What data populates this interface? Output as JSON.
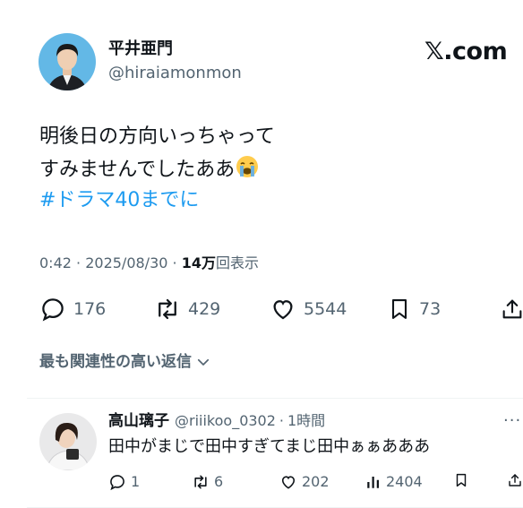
{
  "site_logo": "𝕏.com",
  "author": {
    "display_name": "平井亜門",
    "handle": "@hiraiamonmon"
  },
  "tweet": {
    "text_line1": "明後日の方向いっちゃって",
    "text_line2": "すみませんでしたああ",
    "emoji": "loudly-crying-face-emoji",
    "hashtag": "#ドラマ40までに",
    "time": "0:42",
    "date": "2025/08/30",
    "views_count": "14万",
    "views_label": "回表示"
  },
  "actions": {
    "replies": "176",
    "retweets": "429",
    "likes": "5544",
    "bookmarks": "73"
  },
  "replies_sort_label": "最も関連性の高い返信",
  "reply": {
    "display_name": "高山璃子",
    "handle": "@riiikoo_0302",
    "separator": "·",
    "time": "1時間",
    "text": "田中がまじで田中すぎてまじ田中ぁぁあああ",
    "more": "···",
    "stats": {
      "replies": "1",
      "retweets": "6",
      "likes": "202",
      "views": "2404"
    }
  },
  "colors": {
    "text": "#0f1419",
    "secondary": "#536471",
    "link": "#1d9bf0",
    "divider": "#eff3f4"
  }
}
